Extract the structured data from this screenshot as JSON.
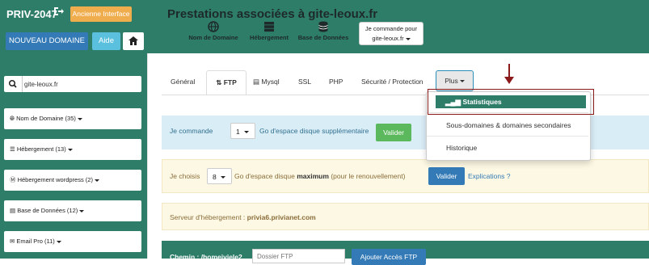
{
  "header": {
    "account": "PRIV-2047",
    "old_interface_label": "Ancienne Interface",
    "new_domain_label": "NOUVEAU DOMAINE",
    "help_label": "Aide",
    "title": "Prestations associées à gite-leoux.fr",
    "nav": [
      {
        "label": "Nom de Domaine",
        "icon": "globe-icon"
      },
      {
        "label": "Hébergement",
        "icon": "server-icon"
      },
      {
        "label": "Base de Données",
        "icon": "database-icon"
      }
    ],
    "order_for": {
      "line1": "Je commande pour",
      "line2": "gite-leoux.fr"
    }
  },
  "sidebar": {
    "search_value": "gite-leoux.fr",
    "items": [
      {
        "label": "Nom de Domaine (35)",
        "icon": "globe-icon"
      },
      {
        "label": "Hébergement (13)",
        "icon": "server-icon"
      },
      {
        "label": "Hébergement wordpress (2)",
        "icon": "wordpress-icon"
      },
      {
        "label": "Base de Données (12)",
        "icon": "database-icon"
      },
      {
        "label": "Email Pro (11)",
        "icon": "envelope-icon"
      }
    ]
  },
  "tabs": [
    {
      "label": "Général"
    },
    {
      "label": "FTP"
    },
    {
      "label": "Mysql"
    },
    {
      "label": "SSL"
    },
    {
      "label": "PHP"
    },
    {
      "label": "Sécurité / Protection"
    },
    {
      "label": "Plus"
    }
  ],
  "dropdown": {
    "items": [
      "Statistiques",
      "Sous-domaines & domaines secondaires",
      "Historique"
    ]
  },
  "order_extra": {
    "prefix": "Je commande",
    "qty": "1",
    "suffix": "Go d'espace disque supplémentaire",
    "button": "Valider"
  },
  "choose_max": {
    "prefix": "Je choisis",
    "qty": "8",
    "suffix_a": "Go d'espace disque",
    "suffix_bold": "maximum",
    "suffix_b": "(pour le renouvellement)",
    "button": "Valider",
    "link": "Explications ?"
  },
  "server": {
    "label": "Serveur d'hébergement :",
    "value": "privia6.privianet.com"
  },
  "bottom": {
    "label": "Chemin : /homeivjele2",
    "placeholder": "Dossier FTP",
    "button": "Ajouter Accès FTP"
  },
  "colors": {
    "brand": "#2e7d69",
    "orange": "#f0ad4e",
    "blue": "#337ab7",
    "cyan": "#5bc0de",
    "annotation": "#8b1a1a"
  }
}
